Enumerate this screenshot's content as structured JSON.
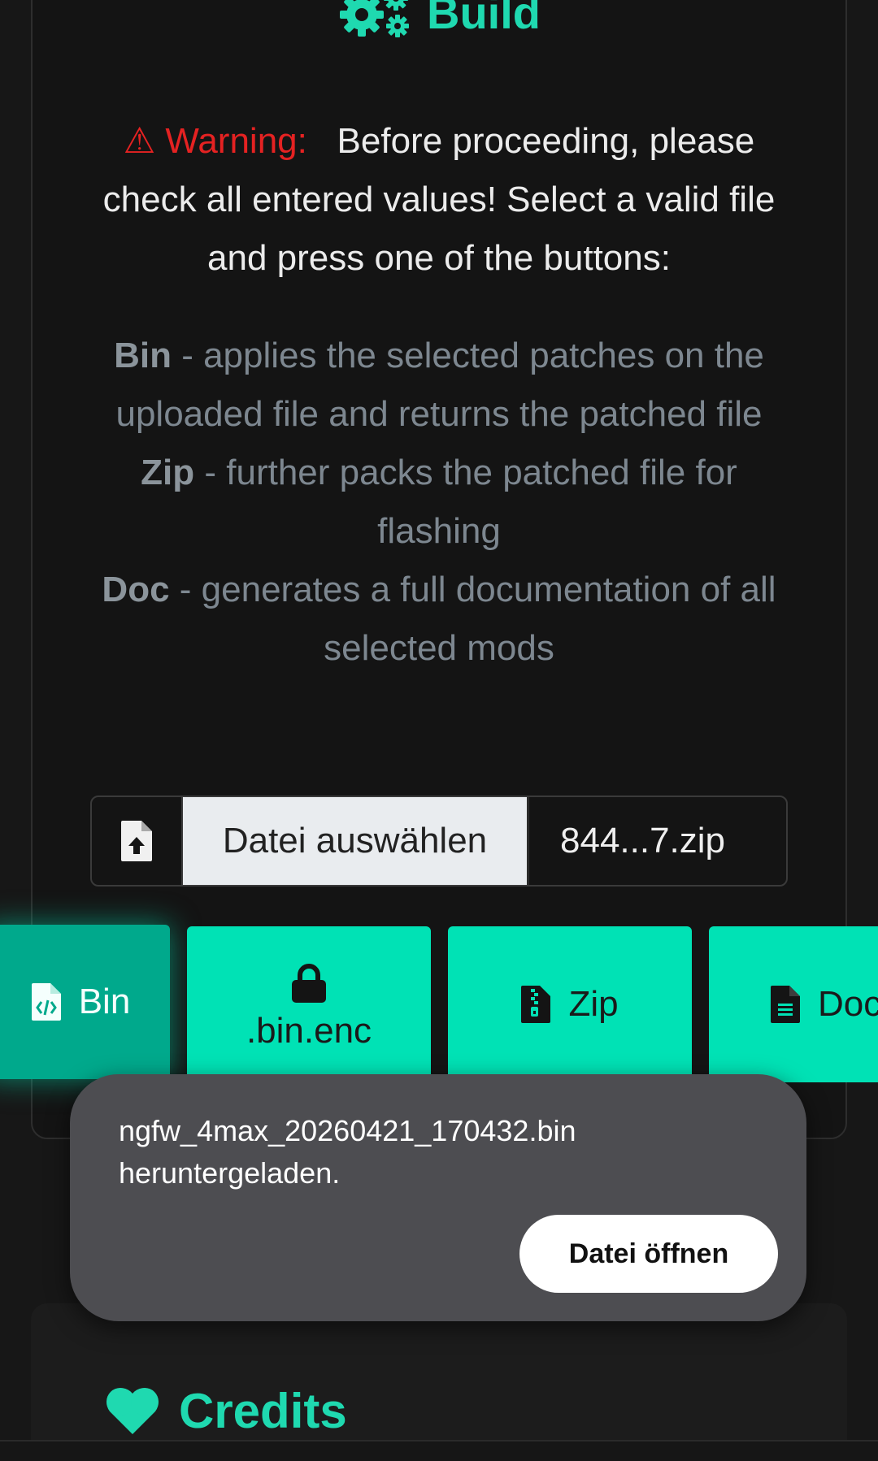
{
  "build": {
    "title": "Build",
    "icon": "gears-icon"
  },
  "warning": {
    "label": "Warning:",
    "text": "Before proceeding, please check all entered values! Select a valid file and press one of the buttons:"
  },
  "descriptions": [
    {
      "term": "Bin",
      "text": "- applies the selected patches on the uploaded file and returns the patched file"
    },
    {
      "term": "Zip",
      "text": "- further packs the patched file for flashing"
    },
    {
      "term": "Doc",
      "text": "- generates a full documentation of all selected mods"
    }
  ],
  "file_input": {
    "button_label": "Datei auswählen",
    "file_name": "844...7.zip",
    "icon": "file-upload-icon"
  },
  "actions": {
    "bin": {
      "label": "Bin",
      "icon": "file-code-icon"
    },
    "bin_enc": {
      "label": ".bin.enc",
      "icon": "lock-icon"
    },
    "zip": {
      "label": "Zip",
      "icon": "file-zip-icon"
    },
    "doc": {
      "label": "Doc",
      "icon": "file-text-icon"
    }
  },
  "toast": {
    "message": "ngfw_4max_20260421_170432.bin heruntergeladen.",
    "action_label": "Datei öffnen"
  },
  "credits": {
    "title": "Credits",
    "icon": "heart-icon"
  },
  "colors": {
    "accent": "#1fd9b0",
    "button": "#00e2b5",
    "button_active": "#00a98c",
    "warning": "#e52222",
    "background": "#171717"
  }
}
